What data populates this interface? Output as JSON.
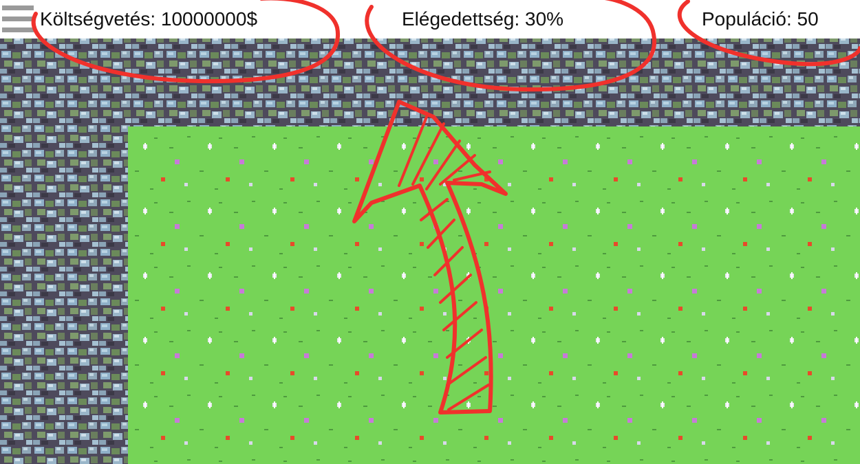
{
  "hud": {
    "budget": "Költségvetés: 10000000$",
    "satisfaction": "Elégedettség: 30%",
    "population": "Populáció: 50"
  },
  "icons": {
    "menu": "menu-icon"
  },
  "colors": {
    "grass": "#76d457",
    "rock_dark": "#4a4656",
    "rock_light": "#8fb0c8",
    "rock_green": "#6b8a5a",
    "annotation": "#f0312c",
    "hud_background": "#ffffff"
  }
}
